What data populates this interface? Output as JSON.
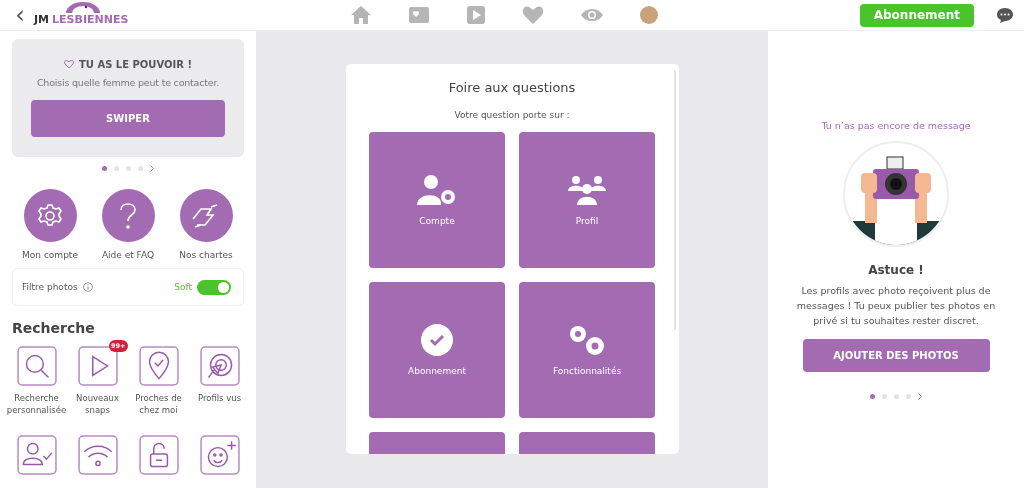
{
  "top_bar": {
    "back": "‹",
    "logo": {
      "prefix": "JM",
      "name": "LESBIENNES"
    },
    "nav": [
      {
        "kind": "home"
      },
      {
        "kind": "cards"
      },
      {
        "kind": "play"
      },
      {
        "kind": "heart"
      },
      {
        "kind": "eye"
      },
      {
        "kind": "avatar"
      }
    ],
    "subscribe_button": "Abonnement"
  },
  "sidebar": {
    "promo": {
      "title": "TU AS LE POUVOIR !",
      "text": "Choisis quelle femme peut te contacter.",
      "button": "SWIPER"
    },
    "promo_dots": [
      {
        "selected": true
      },
      {
        "selected": false
      },
      {
        "selected": false
      },
      {
        "selected": false
      }
    ],
    "shortcuts": [
      {
        "kind": "gear",
        "label": "Mon compte"
      },
      {
        "kind": "question",
        "label": "Aide et FAQ"
      },
      {
        "kind": "hands",
        "label": "Nos chartes"
      }
    ],
    "photo_filter": {
      "label": "Filtre photos",
      "value": "Soft",
      "on": true
    },
    "search_title": "Recherche",
    "search_items": [
      {
        "kind": "search",
        "label": "Recherche personnalisée"
      },
      {
        "kind": "play",
        "label": "Nouveaux snaps",
        "badge": "99+"
      },
      {
        "kind": "pin",
        "label": "Proches de chez moi"
      },
      {
        "kind": "cursor",
        "label": "Profils vus"
      },
      {
        "kind": "user-check"
      },
      {
        "kind": "wifi"
      },
      {
        "kind": "lock"
      },
      {
        "kind": "smiley"
      }
    ]
  },
  "faq": {
    "title": "Foire aux questions",
    "subtitle": "Votre question porte sur :",
    "tiles": [
      {
        "kind": "account",
        "label": "Compte"
      },
      {
        "kind": "profile",
        "label": "Profil"
      },
      {
        "kind": "subscription",
        "label": "Abonnement"
      },
      {
        "kind": "features",
        "label": "Fonctionnalités"
      },
      {
        "kind": "hidden"
      },
      {
        "kind": "hidden"
      }
    ]
  },
  "messages": {
    "empty_text": "Tu n’as pas encore de message",
    "tip_title": "Astuce !",
    "tip_text": "Les profils avec photo reçoivent plus de messages ! Tu peux publier tes photos en privé si tu souhaites rester discret.",
    "button": "AJOUTER DES PHOTOS",
    "dots": [
      {
        "selected": true
      },
      {
        "selected": false
      },
      {
        "selected": false
      },
      {
        "selected": false
      }
    ]
  }
}
